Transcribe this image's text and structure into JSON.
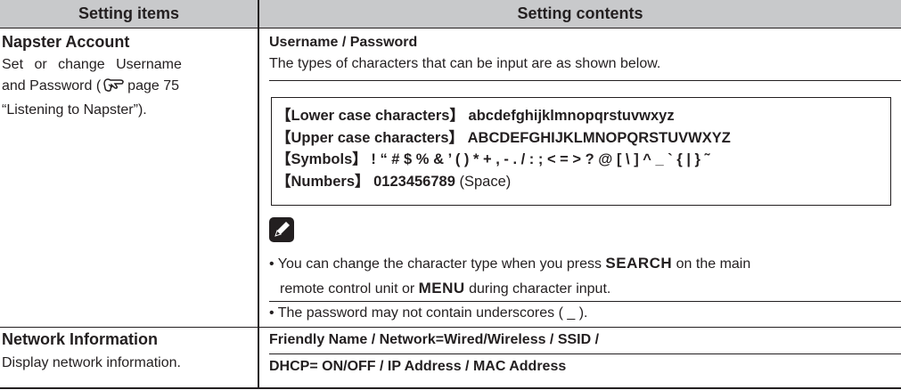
{
  "headers": {
    "items": "Setting items",
    "contents": "Setting contents"
  },
  "napster": {
    "title": "Napster Account",
    "desc_line1": "Set or change Username",
    "desc_line2_pre": "and Password (",
    "desc_line2_post": "page 75",
    "desc_line3": "“Listening to Napster”).",
    "sub_title": "Username / Password",
    "intro": "The types of characters that can be input are as shown below.",
    "chars": {
      "lower_label": "【Lower case characters】",
      "lower_value": "abcdefghijklmnopqrstuvwxyz",
      "upper_label": "【Upper case characters】",
      "upper_value": "ABCDEFGHIJKLMNOPQRSTUVWXYZ",
      "symbols_label": "【Symbols】",
      "symbols_value": "! “ # $ % & ’ ( ) * + , - . / : ; < = > ? @ [ \\ ] ^ _ ` { | } ˜",
      "numbers_label": "【Numbers】",
      "numbers_value": "0123456789",
      "space_label": "(Space)"
    },
    "note_icon": "pencil-icon",
    "bullet1_a": "• You can change the character type when you press ",
    "bullet1_kw1": "SEARCH",
    "bullet1_b": " on the main",
    "bullet1_c": "remote control unit or ",
    "bullet1_kw2": "MENU",
    "bullet1_d": " during character input.",
    "bullet2": "• The password may not contain underscores ( _ )."
  },
  "network": {
    "title": "Network Information",
    "desc": "Display network information.",
    "line1": "Friendly Name / Network=Wired/Wireless / SSID /",
    "line2": "DHCP= ON/OFF / IP Address / MAC Address"
  }
}
